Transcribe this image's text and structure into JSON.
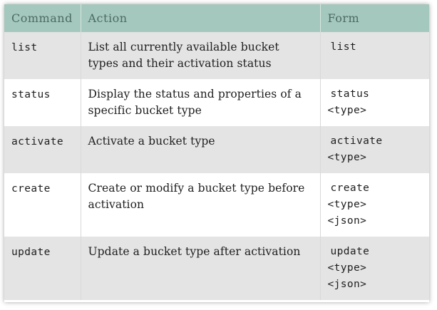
{
  "table": {
    "headers": {
      "command": "Command",
      "action": "Action",
      "form": "Form"
    },
    "rows": [
      {
        "command": "list",
        "action": "List all currently available bucket types and their activation status",
        "form": [
          "list"
        ]
      },
      {
        "command": "status",
        "action": "Display the status and properties of a specific bucket type",
        "form": [
          "status",
          "<type>"
        ]
      },
      {
        "command": "activate",
        "action": "Activate a bucket type",
        "form": [
          "activate",
          "<type>"
        ]
      },
      {
        "command": "create",
        "action": "Create or modify a bucket type before activation",
        "form": [
          "create",
          "<type>",
          "<json>"
        ]
      },
      {
        "command": "update",
        "action": "Update a bucket type after activation",
        "form": [
          "update",
          "<type>",
          "<json>"
        ]
      }
    ]
  },
  "colors": {
    "header_bg": "#a4c8bd",
    "header_text": "#4c6a63",
    "row_shaded": "#e4e4e4",
    "row_plain": "#ffffff"
  }
}
